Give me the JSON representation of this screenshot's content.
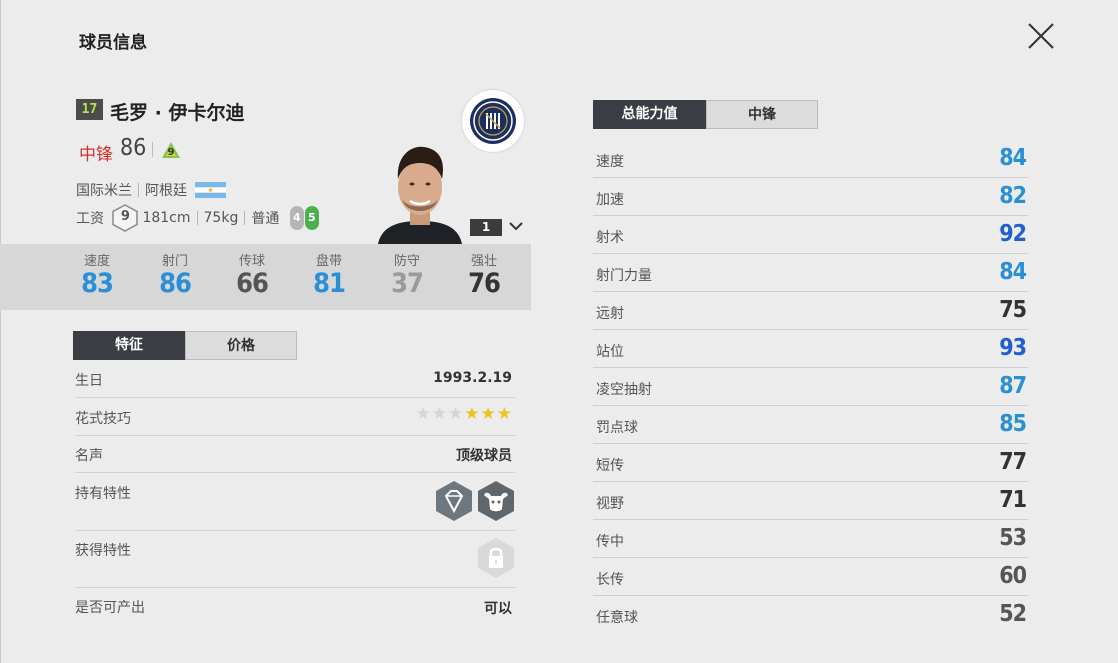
{
  "title": "球员信息",
  "player": {
    "season_badge": "17",
    "name": "毛罗 · 伊卡尔迪",
    "position": "中锋",
    "position_rating": "86",
    "tier": "9",
    "club": "国际米兰",
    "nation": "阿根廷",
    "wage_label": "工资",
    "wage": "9",
    "height": "181cm",
    "weight": "75kg",
    "body_type": "普通",
    "weak_foot": "4",
    "strong_foot": "5",
    "rank": "1"
  },
  "base_stats": [
    {
      "label": "速度",
      "value": "83",
      "color": "#2a8fd4"
    },
    {
      "label": "射门",
      "value": "86",
      "color": "#2a8fd4"
    },
    {
      "label": "传球",
      "value": "66",
      "color": "#555555"
    },
    {
      "label": "盘带",
      "value": "81",
      "color": "#2a8fd4"
    },
    {
      "label": "防守",
      "value": "37",
      "color": "#9a9a9a"
    },
    {
      "label": "强壮",
      "value": "76",
      "color": "#333333"
    }
  ],
  "left_tabs": [
    "特征",
    "价格"
  ],
  "traits": {
    "birthday_label": "生日",
    "birthday": "1993.2.19",
    "skill_label": "花式技巧",
    "skill_stars": 3,
    "skill_stars_max": 6,
    "reputation_label": "名声",
    "reputation": "顶级球员",
    "held_label": "持有特性",
    "gained_label": "获得特性",
    "tradable_label": "是否可产出",
    "tradable": "可以"
  },
  "right_tabs": [
    "总能力值",
    "中锋"
  ],
  "attributes": [
    {
      "label": "速度",
      "value": "84",
      "color": "#2a8fd4"
    },
    {
      "label": "加速",
      "value": "82",
      "color": "#2a8fd4"
    },
    {
      "label": "射术",
      "value": "92",
      "color": "#1f5fd0"
    },
    {
      "label": "射门力量",
      "value": "84",
      "color": "#2a8fd4"
    },
    {
      "label": "远射",
      "value": "75",
      "color": "#333333"
    },
    {
      "label": "站位",
      "value": "93",
      "color": "#1f5fd0"
    },
    {
      "label": "凌空抽射",
      "value": "87",
      "color": "#2a8fd4"
    },
    {
      "label": "罚点球",
      "value": "85",
      "color": "#2a8fd4"
    },
    {
      "label": "短传",
      "value": "77",
      "color": "#333333"
    },
    {
      "label": "视野",
      "value": "71",
      "color": "#333333"
    },
    {
      "label": "传中",
      "value": "53",
      "color": "#555555"
    },
    {
      "label": "长传",
      "value": "60",
      "color": "#555555"
    },
    {
      "label": "任意球",
      "value": "52",
      "color": "#555555"
    }
  ]
}
